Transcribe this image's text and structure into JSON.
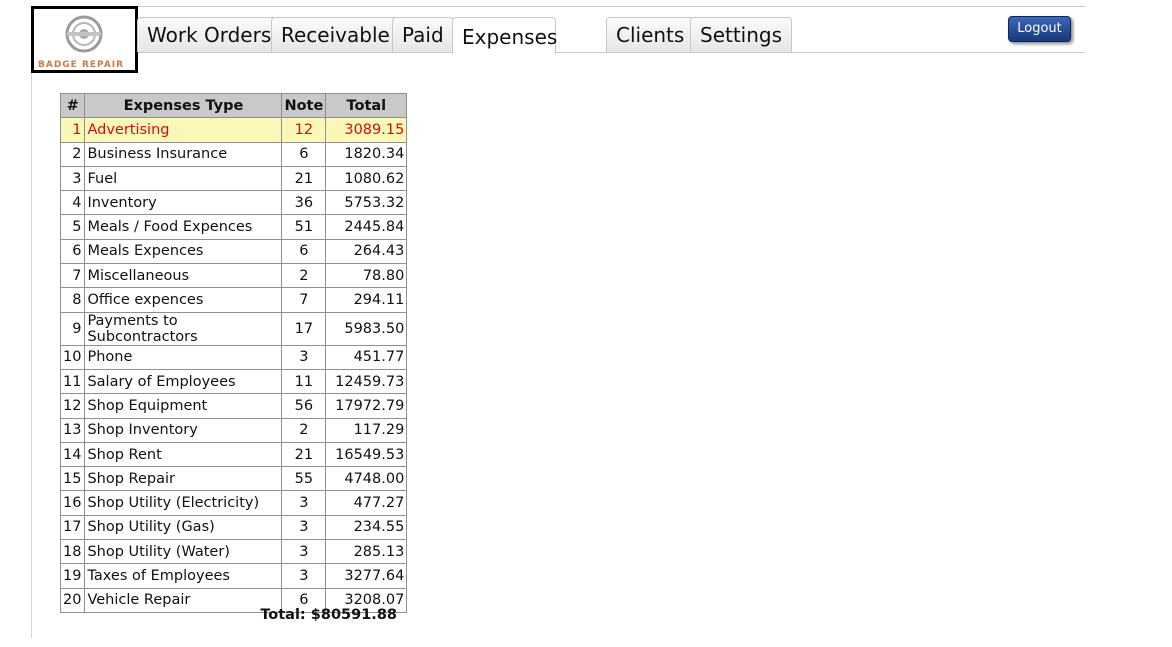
{
  "app": {
    "logo_text": "BADGE REPAIR"
  },
  "nav": {
    "tabs": [
      {
        "label": "Work Orders",
        "active": false
      },
      {
        "label": "Receivable",
        "active": false
      },
      {
        "label": "Paid",
        "active": false
      },
      {
        "label": "Expenses",
        "active": true
      },
      {
        "label": "Clients",
        "active": false
      },
      {
        "label": "Settings",
        "active": false
      }
    ],
    "logout_label": "Logout"
  },
  "table": {
    "headers": {
      "num": "#",
      "type": "Expenses Type",
      "note": "Note",
      "total": "Total"
    },
    "rows": [
      {
        "num": "1",
        "type": "Advertising",
        "note": "12",
        "total": "3089.15"
      },
      {
        "num": "2",
        "type": "Business Insurance",
        "note": "6",
        "total": "1820.34"
      },
      {
        "num": "3",
        "type": "Fuel",
        "note": "21",
        "total": "1080.62"
      },
      {
        "num": "4",
        "type": "Inventory",
        "note": "36",
        "total": "5753.32"
      },
      {
        "num": "5",
        "type": "Meals / Food Expences",
        "note": "51",
        "total": "2445.84"
      },
      {
        "num": "6",
        "type": "Meals Expences",
        "note": "6",
        "total": "264.43"
      },
      {
        "num": "7",
        "type": "Miscellaneous",
        "note": "2",
        "total": "78.80"
      },
      {
        "num": "8",
        "type": "Office expences",
        "note": "7",
        "total": "294.11"
      },
      {
        "num": "9",
        "type": "Payments to Subcontractors",
        "note": "17",
        "total": "5983.50"
      },
      {
        "num": "10",
        "type": "Phone",
        "note": "3",
        "total": "451.77"
      },
      {
        "num": "11",
        "type": "Salary of Employees",
        "note": "11",
        "total": "12459.73"
      },
      {
        "num": "12",
        "type": "Shop Equipment",
        "note": "56",
        "total": "17972.79"
      },
      {
        "num": "13",
        "type": "Shop Inventory",
        "note": "2",
        "total": "117.29"
      },
      {
        "num": "14",
        "type": "Shop Rent",
        "note": "21",
        "total": "16549.53"
      },
      {
        "num": "15",
        "type": "Shop Repair",
        "note": "55",
        "total": "4748.00"
      },
      {
        "num": "16",
        "type": "Shop Utility (Electricity)",
        "note": "3",
        "total": "477.27"
      },
      {
        "num": "17",
        "type": "Shop Utility (Gas)",
        "note": "3",
        "total": "234.55"
      },
      {
        "num": "18",
        "type": "Shop Utility (Water)",
        "note": "3",
        "total": "285.13"
      },
      {
        "num": "19",
        "type": "Taxes of Employees",
        "note": "3",
        "total": "3277.64"
      },
      {
        "num": "20",
        "type": "Vehicle Repair",
        "note": "6",
        "total": "3208.07"
      }
    ],
    "highlighted_row": "1",
    "grand_total": "Total: $80591.88"
  },
  "colors": {
    "highlight_bg": "#fbf7b8",
    "highlight_text": "#d01010",
    "header_bg": "#c9c9c9",
    "logout_bg": "#1f4591"
  }
}
